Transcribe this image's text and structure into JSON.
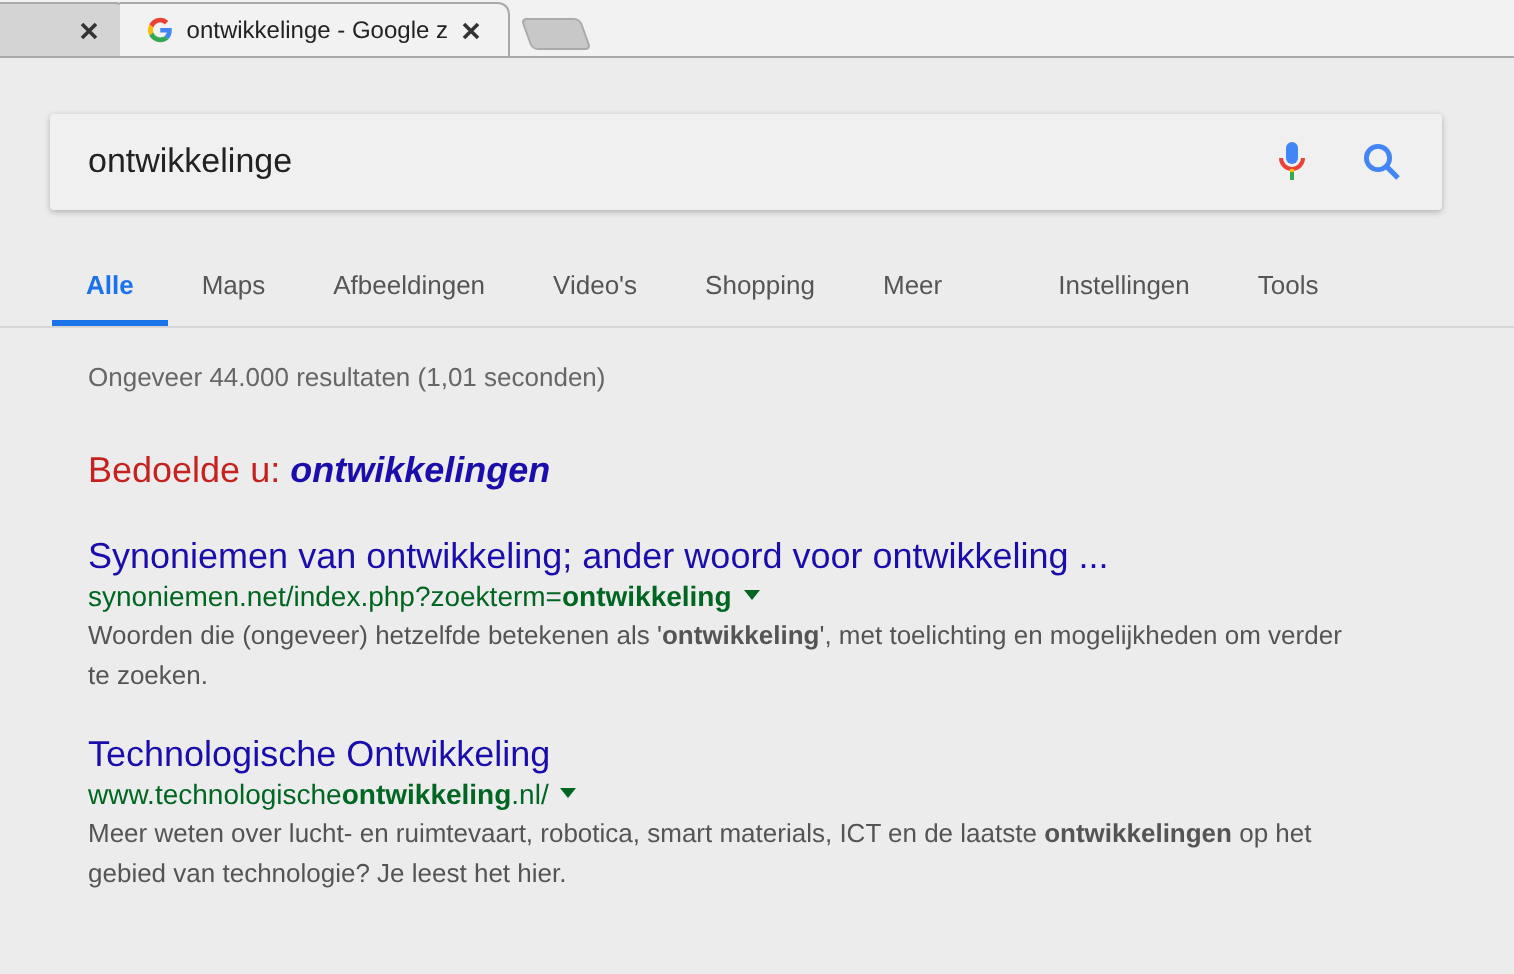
{
  "browser_tabs": [
    {
      "selected": false
    },
    {
      "title": "ontwikkelinge - Google z",
      "selected": true
    }
  ],
  "search": {
    "value": "ontwikkelinge"
  },
  "nav_tabs": [
    {
      "label": "Alle",
      "selected": true
    },
    {
      "label": "Maps",
      "selected": false
    },
    {
      "label": "Afbeeldingen",
      "selected": false
    },
    {
      "label": "Video's",
      "selected": false
    },
    {
      "label": "Shopping",
      "selected": false
    },
    {
      "label": "Meer",
      "selected": false
    }
  ],
  "nav_tools": [
    "Instellingen",
    "Tools"
  ],
  "result_stats": "Ongeveer 44.000 resultaten (1,01 seconden)",
  "did_you_mean": {
    "label": "Bedoelde u:",
    "suggestion": "ontwikkelingen"
  },
  "results": [
    {
      "title": "Synoniemen van ontwikkeling; ander woord voor ontwikkeling ...",
      "url": "synoniemen.net/index.php?zoekterm=**ontwikkeling**",
      "snippet": "Woorden die (ongeveer) hetzelfde betekenen als '**ontwikkeling**', met toelichting en mogelijkheden om verder te zoeken."
    },
    {
      "title": "Technologische Ontwikkeling",
      "url": "www.technologische**ontwikkeling**.nl/",
      "snippet": "Meer weten over lucht- en ruimtevaart, robotica, smart materials, ICT en de laatste **ontwikkelingen** op het gebied van technologie? Je leest het hier."
    }
  ]
}
